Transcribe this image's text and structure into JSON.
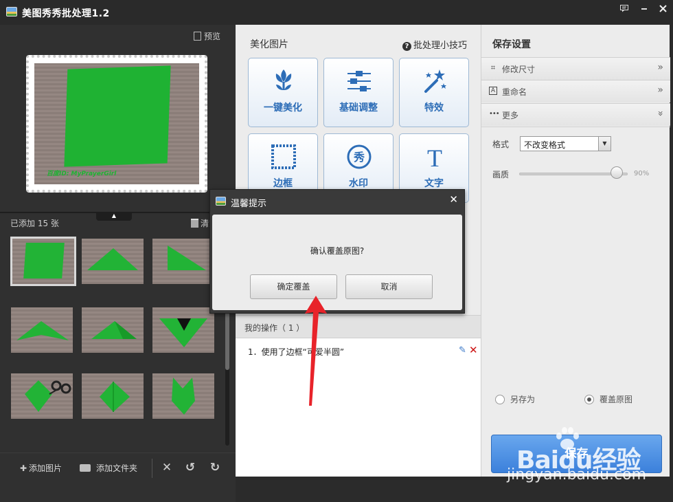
{
  "window": {
    "title": "美图秀秀批处理1.2",
    "controls": [
      "feedback-icon",
      "minimize-icon",
      "close-icon"
    ]
  },
  "left": {
    "preview_label": "预览",
    "preview_watermark": "百度ID: MyPrayerGirl",
    "added_count": "已添加 15 张",
    "clear_label": "清空",
    "toolbar": {
      "add_image": "添加图片",
      "add_folder": "添加文件夹"
    }
  },
  "middle": {
    "section_title": "美化图片",
    "tips_label": "批处理小技巧",
    "tools": [
      {
        "label": "一键美化",
        "icon": "tulip-icon"
      },
      {
        "label": "基础调整",
        "icon": "sliders-icon"
      },
      {
        "label": "特效",
        "icon": "magic-wand-icon"
      },
      {
        "label": "边框",
        "icon": "frame-icon"
      },
      {
        "label": "水印",
        "icon": "watermark-icon"
      },
      {
        "label": "文字",
        "icon": "text-icon"
      }
    ],
    "ops_title": "我的操作（ 1 ）",
    "op_item": "1．使用了边框“可爱半圆”"
  },
  "right": {
    "title": "保存设置",
    "rows": [
      {
        "label": "修改尺寸",
        "icon": "crop-icon"
      },
      {
        "label": "重命名",
        "icon": "rename-icon"
      },
      {
        "label": "更多",
        "icon": "more-icon"
      }
    ],
    "format_label": "格式",
    "format_value": "不改变格式",
    "quality_label": "画质",
    "quality_value": "90%",
    "quality_fraction": 0.9,
    "radio_save_as": "另存为",
    "radio_overwrite": "覆盖原图",
    "selected_radio": "overwrite",
    "save_button": "保存"
  },
  "dialog": {
    "title": "温馨提示",
    "message": "确认覆盖原图?",
    "confirm": "确定覆盖",
    "cancel": "取消"
  },
  "watermark": {
    "logo": "Baidu经验",
    "url": "jingyan.baidu.com"
  },
  "colors": {
    "accent": "#2d6db7",
    "save_button": "#4a8fe3",
    "paper_green": "#1fb233",
    "annotation_red": "#e8232a"
  }
}
